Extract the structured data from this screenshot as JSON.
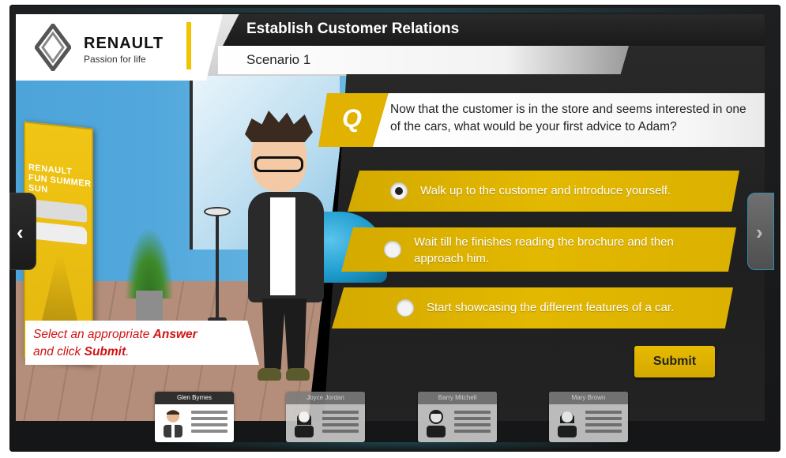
{
  "brand": {
    "name": "RENAULT",
    "tagline": "Passion for life",
    "accent_color": "#f2c300"
  },
  "header": {
    "title": "Establish Customer Relations",
    "subtitle": "Scenario 1"
  },
  "scene": {
    "poster_title": "RENAULT FUN SUMMER SUN"
  },
  "question": {
    "badge": "Q",
    "text": "Now that the customer is in the store and seems interested in one of the cars, what would be your first advice to Adam?"
  },
  "options": [
    {
      "label": "Walk up to the customer and introduce yourself.",
      "selected": true
    },
    {
      "label": "Wait till he finishes reading the brochure and then approach him.",
      "selected": false
    },
    {
      "label": "Start showcasing the different features of a car.",
      "selected": false
    }
  ],
  "submit_label": "Submit",
  "instruction": {
    "part1": "Select an appropriate ",
    "emph1": "Answer",
    "part2": "and click ",
    "emph2": "Submit",
    "part3": "."
  },
  "nav": {
    "prev_icon": "chevron-left-icon",
    "next_icon": "chevron-right-icon",
    "prev_glyph": "‹",
    "next_glyph": "›"
  },
  "characters": [
    {
      "name": "Glen Byrnes",
      "state": "active"
    },
    {
      "name": "Joyce Jordan",
      "state": "inactive"
    },
    {
      "name": "Barry Mitchell",
      "state": "inactive"
    },
    {
      "name": "Mary Brown",
      "state": "inactive"
    }
  ]
}
